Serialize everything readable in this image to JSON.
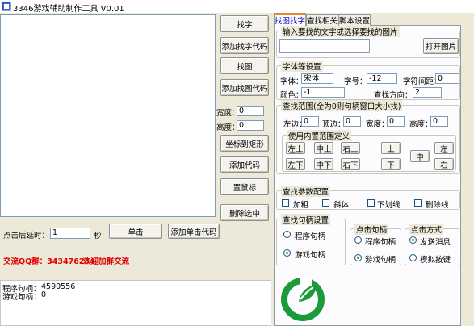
{
  "window": {
    "title": "3346游戏辅助制作工具 V0.01"
  },
  "left_buttons": {
    "find_text": "找字",
    "add_find_text_code": "添加找字代码",
    "find_image": "找图",
    "add_find_image_code": "添加找图代码",
    "coords_to_rect": "坐标到矩形",
    "add_code": "添加代码",
    "set_mouse": "置鼠标",
    "delete_selected": "删除选中"
  },
  "size_fields": {
    "width_label": "宽度：",
    "width_value": "0",
    "height_label": "高度：",
    "height_value": "0"
  },
  "click": {
    "delay_label": "点击后延时：",
    "delay_value": "1",
    "unit": "秒",
    "click_button": "单击",
    "add_click_code_button": "添加单击代码"
  },
  "promo": {
    "qq_group": "交流QQ群：343476234",
    "welcome": "欢迎加群交流"
  },
  "handles": {
    "program_label": "程序句柄：",
    "program_value": "4590556",
    "game_label": "游戏句柄：",
    "game_value": "0"
  },
  "tabs": [
    {
      "label": "找图找字"
    },
    {
      "label": "查找相关"
    },
    {
      "label": "脚本设置"
    }
  ],
  "find_input": {
    "group_title": "输入要找的文字或选择要找的图片",
    "value": "",
    "open_image_button": "打开图片"
  },
  "font_settings": {
    "group_title": "字体等设置",
    "font_label": "字体：",
    "font_value": "宋体",
    "size_label": "字号：",
    "size_value": "-12",
    "spacing_label": "字符间距：",
    "spacing_value": "0",
    "color_label": "颜色：",
    "color_value": "-1",
    "direction_label": "查找方向：",
    "direction_value": "2"
  },
  "find_range": {
    "group_title": "查找范围(全为0则句柄窗口大小找)",
    "left_label": "左边：",
    "left_value": "0",
    "top_label": "顶边：",
    "top_value": "0",
    "width_label": "宽度：",
    "width_value": "0",
    "height_label": "高度：",
    "height_value": "0",
    "preset_title": "使用内置范围定义",
    "presets": {
      "top_left": "左上",
      "top_center": "中上",
      "top_right": "右上",
      "bottom_left": "左下",
      "bottom_center": "中下",
      "bottom_right": "右下",
      "up": "上",
      "down": "下",
      "center": "中",
      "left": "左",
      "right": "右"
    }
  },
  "find_params": {
    "group_title": "查找参数配置",
    "options": [
      {
        "label": "加粗"
      },
      {
        "label": "斜体"
      },
      {
        "label": "下划线"
      },
      {
        "label": "删除线"
      }
    ]
  },
  "find_handle": {
    "group_title": "查找句柄设置",
    "options": [
      {
        "label": "程序句柄"
      },
      {
        "label": "游戏句柄"
      }
    ]
  },
  "click_handle": {
    "group_title": "点击句柄",
    "options": [
      {
        "label": "程序句柄"
      },
      {
        "label": "游戏句柄"
      }
    ]
  },
  "click_method": {
    "group_title": "点击方式",
    "options": [
      {
        "label": "发送消息"
      },
      {
        "label": "模拟按键"
      }
    ]
  },
  "colors": {
    "logo_green": "#1b9a3a",
    "promo_red": "#e00000"
  }
}
